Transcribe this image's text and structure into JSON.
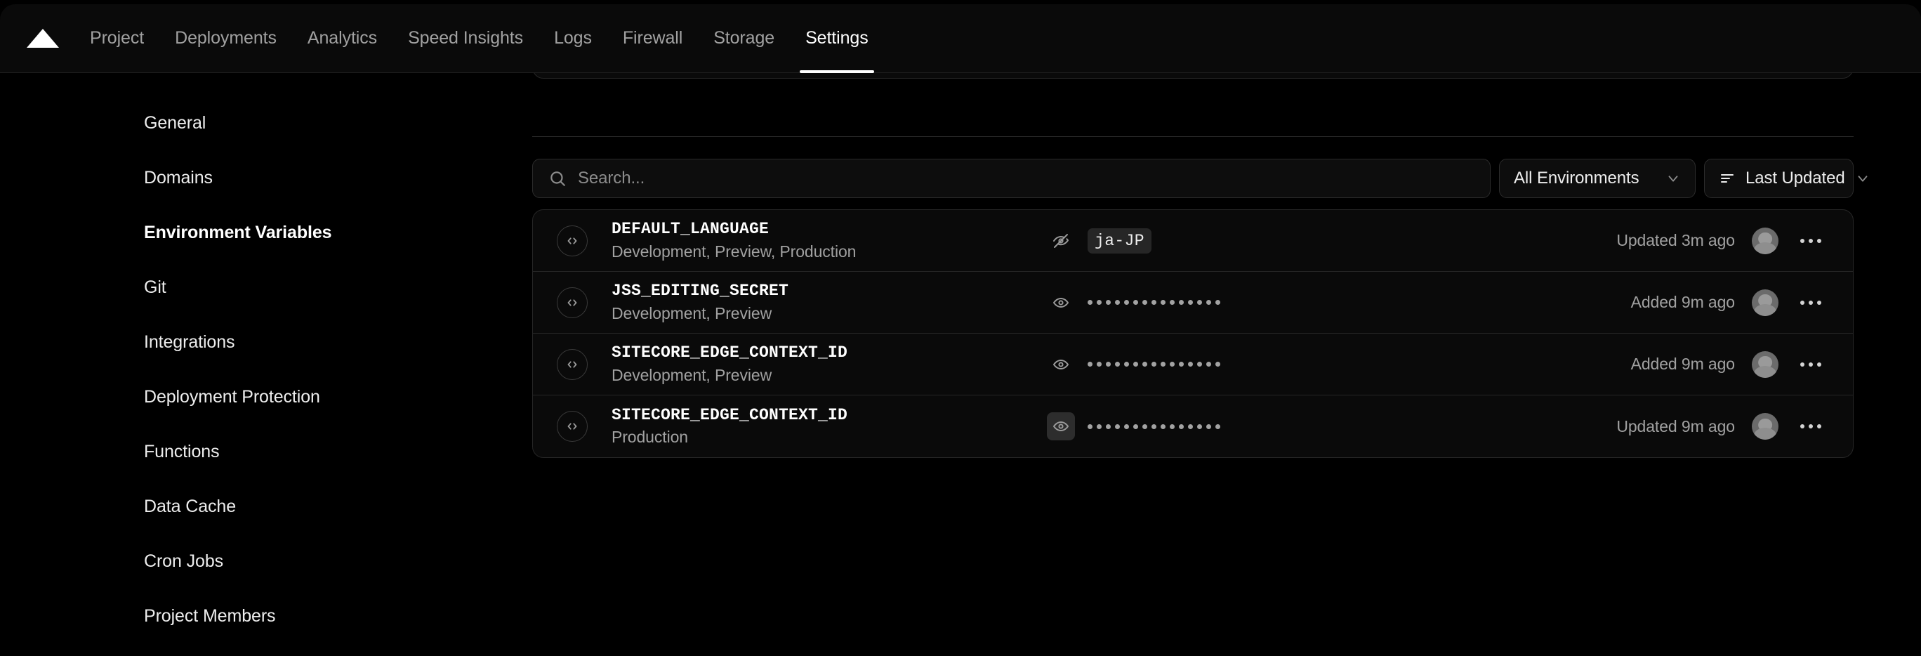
{
  "topnav": {
    "logo_icon": "vercel-triangle-logo",
    "items": [
      {
        "label": "Project",
        "active": false
      },
      {
        "label": "Deployments",
        "active": false
      },
      {
        "label": "Analytics",
        "active": false
      },
      {
        "label": "Speed Insights",
        "active": false
      },
      {
        "label": "Logs",
        "active": false
      },
      {
        "label": "Firewall",
        "active": false
      },
      {
        "label": "Storage",
        "active": false
      },
      {
        "label": "Settings",
        "active": true
      }
    ]
  },
  "sidebar": {
    "items": [
      {
        "label": "General",
        "active": false
      },
      {
        "label": "Domains",
        "active": false
      },
      {
        "label": "Environment Variables",
        "active": true
      },
      {
        "label": "Git",
        "active": false
      },
      {
        "label": "Integrations",
        "active": false
      },
      {
        "label": "Deployment Protection",
        "active": false
      },
      {
        "label": "Functions",
        "active": false
      },
      {
        "label": "Data Cache",
        "active": false
      },
      {
        "label": "Cron Jobs",
        "active": false
      },
      {
        "label": "Project Members",
        "active": false
      }
    ]
  },
  "toolbar": {
    "search_placeholder": "Search...",
    "search_value": "",
    "search_icon": "search-icon",
    "environment_filter": {
      "label": "All Environments",
      "chevron_icon": "chevron-down-icon"
    },
    "sort_control": {
      "label": "Last Updated",
      "sort_icon": "sort-lines-icon",
      "chevron_icon": "chevron-down-icon"
    }
  },
  "variables": [
    {
      "key": "DEFAULT_LANGUAGE",
      "environments": "Development, Preview, Production",
      "code_icon": "code-brackets-icon",
      "visibility_icon": "eye-off-icon",
      "visibility_hovered": false,
      "value_type": "plain",
      "value": "ja-JP",
      "masked_dots": 0,
      "timestamp": "Updated 3m ago",
      "avatar_icon": "user-avatar",
      "menu_icon": "more-horizontal-icon"
    },
    {
      "key": "JSS_EDITING_SECRET",
      "environments": "Development, Preview",
      "code_icon": "code-brackets-icon",
      "visibility_icon": "eye-icon",
      "visibility_hovered": false,
      "value_type": "masked",
      "value": "",
      "masked_dots": 15,
      "timestamp": "Added 9m ago",
      "avatar_icon": "user-avatar",
      "menu_icon": "more-horizontal-icon"
    },
    {
      "key": "SITECORE_EDGE_CONTEXT_ID",
      "environments": "Development, Preview",
      "code_icon": "code-brackets-icon",
      "visibility_icon": "eye-icon",
      "visibility_hovered": false,
      "value_type": "masked",
      "value": "",
      "masked_dots": 15,
      "timestamp": "Added 9m ago",
      "avatar_icon": "user-avatar",
      "menu_icon": "more-horizontal-icon"
    },
    {
      "key": "SITECORE_EDGE_CONTEXT_ID",
      "environments": "Production",
      "code_icon": "code-brackets-icon",
      "visibility_icon": "eye-icon",
      "visibility_hovered": true,
      "value_type": "masked",
      "value": "",
      "masked_dots": 15,
      "timestamp": "Updated 9m ago",
      "avatar_icon": "user-avatar",
      "menu_icon": "more-horizontal-icon"
    }
  ],
  "colors": {
    "background": "#000000",
    "surface": "#0a0a0a",
    "border": "#262626",
    "text_primary": "#ededed",
    "text_secondary": "#a1a1a1",
    "accent": "#ffffff"
  }
}
